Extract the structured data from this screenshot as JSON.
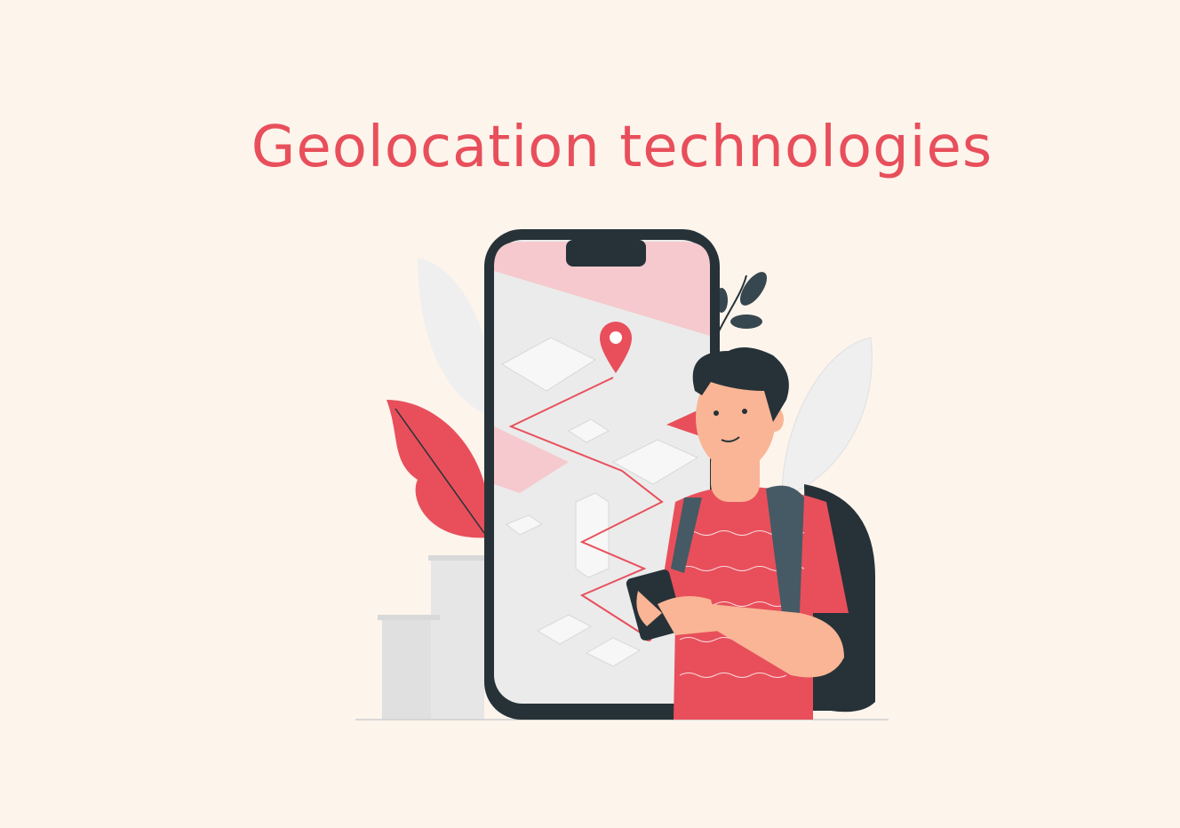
{
  "title": "Geolocation technologies",
  "colors": {
    "background": "#fdf4ec",
    "accent": "#e84f5b",
    "dark": "#263238",
    "skin": "#f9b595"
  },
  "illustration": "person-with-phone-map-icon"
}
